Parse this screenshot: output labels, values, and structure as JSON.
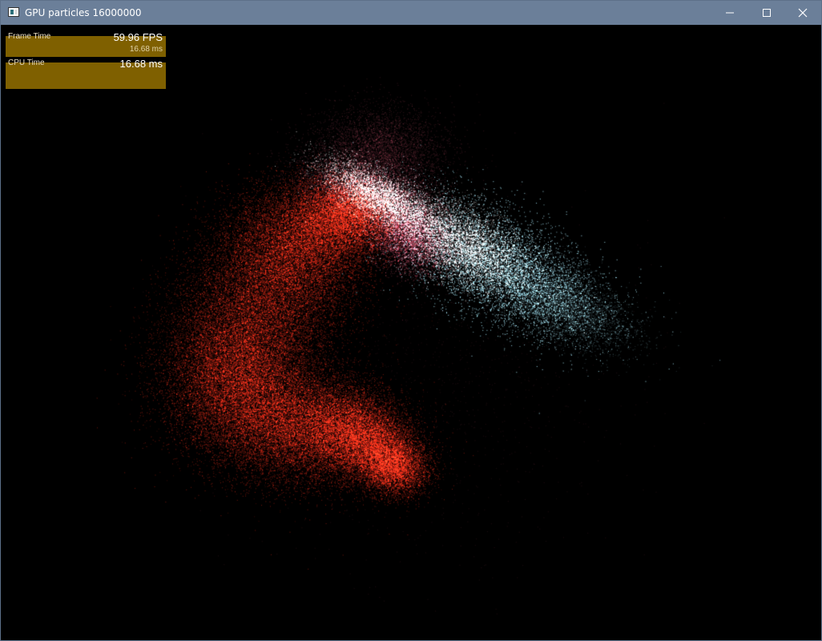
{
  "window": {
    "title": "GPU particles 16000000",
    "icon": "app-window-icon"
  },
  "controls": {
    "minimize_icon": "minimize-icon",
    "maximize_icon": "maximize-icon",
    "close_icon": "close-icon"
  },
  "stats": {
    "frame_time": {
      "label": "Frame Time",
      "fps": "59.96 FPS",
      "ms": "16.68 ms"
    },
    "cpu_time": {
      "label": "CPU Time",
      "ms": "16.68 ms"
    },
    "panel_color": "#7f6000"
  },
  "scene": {
    "particle_colors": {
      "red": "#ff2a10",
      "pink": "#ff6080",
      "white": "#ffffff",
      "cyan": "#a8ecff"
    },
    "background": "#000000"
  }
}
